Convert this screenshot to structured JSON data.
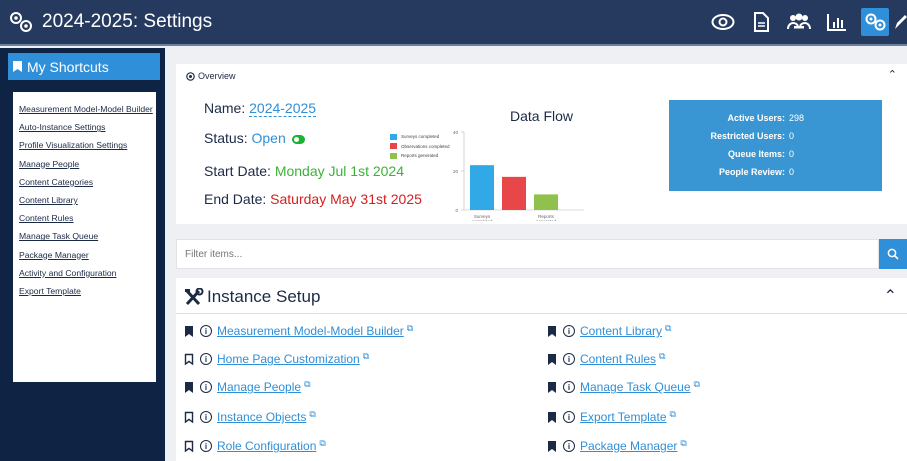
{
  "header": {
    "title": "2024-2025: Settings",
    "icons": [
      "eye-icon",
      "document-icon",
      "people-icon",
      "bar-chart-icon",
      "gears-icon",
      "pencil-icon"
    ]
  },
  "sidebar": {
    "heading": "My Shortcuts",
    "links": [
      "Measurement Model-Model Builder",
      "Auto-Instance Settings",
      "Profile Visualization Settings",
      "Manage People",
      "Content Categories",
      "Content Library",
      "Content Rules",
      "Manage Task Queue",
      "Package Manager",
      "Activity and Configuration",
      "Export Template"
    ]
  },
  "overview": {
    "label": "Overview",
    "name_label": "Name:",
    "name_value": "2024-2025",
    "status_label": "Status:",
    "status_value": "Open",
    "start_label": "Start Date:",
    "start_value": "Monday Jul 1st 2024",
    "end_label": "End Date:",
    "end_value": "Saturday May 31st 2025"
  },
  "chart_data": {
    "type": "bar",
    "title": "Data Flow",
    "categories": [
      "Surveys completed",
      "Observations completed",
      "Reports generated"
    ],
    "x_tick_labels": [
      "Surveys completed",
      "Reports generated"
    ],
    "values": [
      23,
      17,
      8
    ],
    "colors": [
      "#30a9e6",
      "#e8474a",
      "#8fc14d"
    ],
    "ylim": [
      0,
      40
    ],
    "yticks": [
      0,
      20,
      40
    ],
    "legend_position": "right"
  },
  "stats": [
    {
      "label": "Active Users:",
      "value": "298"
    },
    {
      "label": "Restricted Users:",
      "value": "0"
    },
    {
      "label": "Queue Items:",
      "value": "0"
    },
    {
      "label": "People Review:",
      "value": "0"
    }
  ],
  "filter": {
    "placeholder": "Filter items..."
  },
  "setup": {
    "title": "Instance Setup",
    "items": [
      {
        "label": "Measurement Model-Model Builder",
        "bookmarked": true
      },
      {
        "label": "Home Page Customization",
        "bookmarked": false
      },
      {
        "label": "Manage People",
        "bookmarked": true
      },
      {
        "label": "Instance Objects",
        "bookmarked": false
      },
      {
        "label": "Role Configuration",
        "bookmarked": false
      },
      {
        "label": "Content Library",
        "bookmarked": true
      },
      {
        "label": "Content Rules",
        "bookmarked": true
      },
      {
        "label": "Manage Task Queue",
        "bookmarked": true
      },
      {
        "label": "Export Template",
        "bookmarked": true
      },
      {
        "label": "Package Manager",
        "bookmarked": true
      }
    ]
  },
  "colors": {
    "header_bg": "#263a5f",
    "sidebar_bg": "#0f2444",
    "accent": "#2f8fd8",
    "stats_bg": "#3a96d3",
    "status_green": "#3db23a",
    "end_date_red": "#d21f1f"
  }
}
